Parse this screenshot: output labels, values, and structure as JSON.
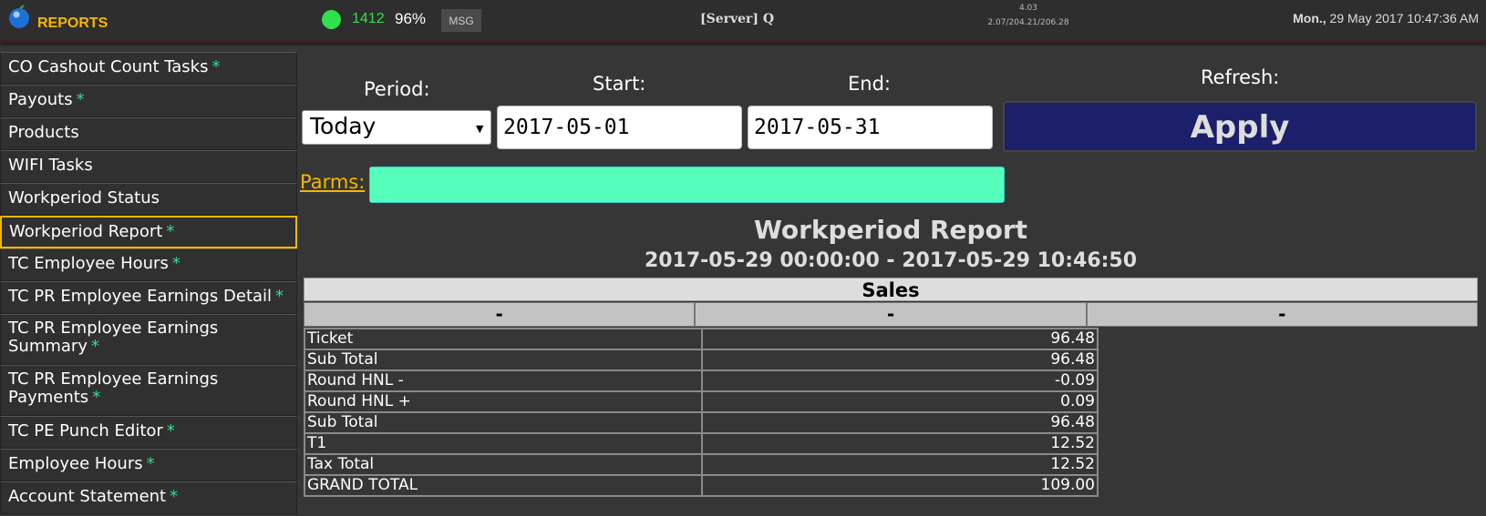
{
  "header": {
    "app_title": "REPORTS",
    "status_count": "1412",
    "status_percent": "96%",
    "msg_label": "MSG",
    "server_label": "[Server] Q",
    "version_top": "4.03",
    "version_bottom": "2.07/204.21/206.28",
    "datetime_day": "Mon.,",
    "datetime_rest": " 29 May 2017 10:47:36 AM"
  },
  "sidebar": {
    "items": [
      {
        "label": "CO Cashout Count Tasks",
        "star": "*"
      },
      {
        "label": "Payouts",
        "star": "*"
      },
      {
        "label": "Products",
        "star": ""
      },
      {
        "label": "WIFI Tasks",
        "star": ""
      },
      {
        "label": "Workperiod Status",
        "star": ""
      },
      {
        "label": "Workperiod Report",
        "star": "*"
      },
      {
        "label": "TC Employee Hours",
        "star": "*"
      },
      {
        "label": "TC PR Employee Earnings Detail",
        "star": "*"
      },
      {
        "label": "TC PR Employee Earnings Summary",
        "star": "*"
      },
      {
        "label": "TC PR Employee Earnings Payments",
        "star": "*"
      },
      {
        "label": "TC PE Punch Editor",
        "star": "*"
      },
      {
        "label": "Employee Hours",
        "star": "*"
      },
      {
        "label": "Account Statement",
        "star": "*"
      }
    ]
  },
  "form": {
    "period_label": "Period:",
    "period_value": "Today",
    "start_label": "Start:",
    "start_value": "2017-05-01",
    "end_label": "End:",
    "end_value": "2017-05-31",
    "refresh_label": "Refresh:",
    "apply_label": "Apply",
    "parms_label": "Parms:",
    "parms_value": ""
  },
  "report": {
    "title": "Workperiod Report",
    "range": "2017-05-29 00:00:00 - 2017-05-29 10:46:50",
    "section": "Sales",
    "columns": [
      "-",
      "-",
      "-"
    ],
    "rows": [
      {
        "label": "Ticket",
        "value": "96.48"
      },
      {
        "label": "Sub Total",
        "value": "96.48"
      },
      {
        "label": "Round HNL -",
        "value": "-0.09"
      },
      {
        "label": "Round HNL +",
        "value": "0.09"
      },
      {
        "label": "Sub Total",
        "value": "96.48"
      },
      {
        "label": "T1",
        "value": "12.52"
      },
      {
        "label": "Tax Total",
        "value": "12.52"
      },
      {
        "label": "GRAND TOTAL",
        "value": "109.00"
      }
    ]
  }
}
